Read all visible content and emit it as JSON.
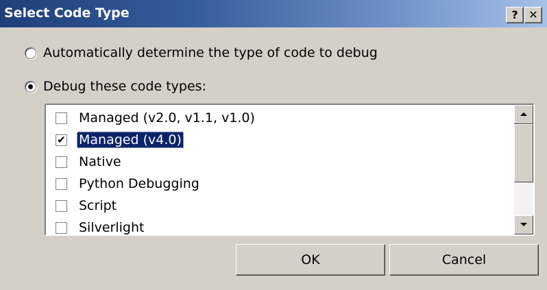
{
  "window": {
    "title": "Select Code Type",
    "help_glyph": "?",
    "close_glyph": "✕"
  },
  "options": {
    "auto": {
      "label": "Automatically determine the type of code to debug",
      "checked": false
    },
    "debug": {
      "label": "Debug these code types:",
      "checked": true
    }
  },
  "code_types": [
    {
      "label": "Managed (v2.0, v1.1, v1.0)",
      "checked": false,
      "selected": false
    },
    {
      "label": "Managed (v4.0)",
      "checked": true,
      "selected": true
    },
    {
      "label": "Native",
      "checked": false,
      "selected": false
    },
    {
      "label": "Python Debugging",
      "checked": false,
      "selected": false
    },
    {
      "label": "Script",
      "checked": false,
      "selected": false
    },
    {
      "label": "Silverlight",
      "checked": false,
      "selected": false
    }
  ],
  "buttons": {
    "ok": "OK",
    "cancel": "Cancel"
  },
  "colors": {
    "selection": "#0a246a",
    "titlebar_start": "#1f3f79",
    "titlebar_end": "#a6c0e8"
  }
}
